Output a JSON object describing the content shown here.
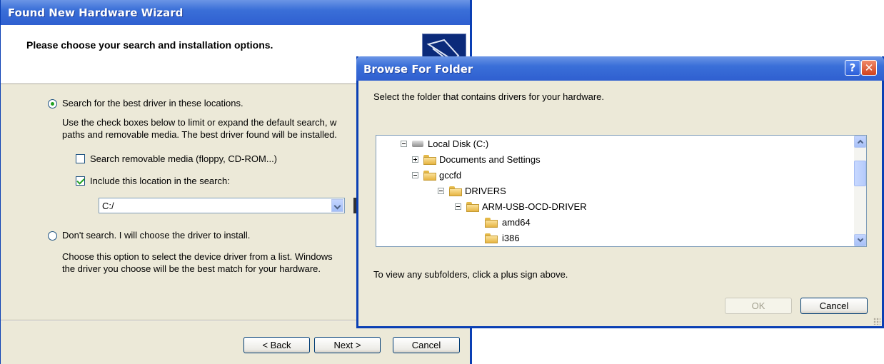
{
  "wizard": {
    "title": "Found New Hardware Wizard",
    "heading": "Please choose your search and installation options.",
    "search_option_label": "Search for the best driver in these locations.",
    "search_desc_line1": "Use the check boxes below to limit or expand the default search, w",
    "search_desc_line2": "paths and removable media. The best driver found will be installed.",
    "removable_media_label": "Search removable media (floppy, CD-ROM...)",
    "removable_media_checked": false,
    "include_location_label": "Include this location in the search:",
    "include_location_checked": true,
    "location_value": "C:/",
    "dont_search_label": "Don't search. I will choose the driver to install.",
    "dont_search_desc_line1": "Choose this option to select the device driver from a list.  Windows",
    "dont_search_desc_line2": "the driver you choose will be the best match for your hardware.",
    "selected_option": "search",
    "back_label": "< Back",
    "next_label": "Next >",
    "cancel_label": "Cancel"
  },
  "browse": {
    "title": "Browse For Folder",
    "help_glyph": "?",
    "close_glyph": "✕",
    "instruction": "Select the folder that contains drivers for your hardware.",
    "tree": [
      {
        "label": "Local Disk (C:)",
        "icon": "disk-icon",
        "expander": "minus"
      },
      {
        "label": "Documents and Settings",
        "icon": "folder-icon",
        "expander": "plus"
      },
      {
        "label": "gccfd",
        "icon": "folder-icon",
        "expander": "minus"
      },
      {
        "label": "DRIVERS",
        "icon": "folder-icon",
        "expander": "minus"
      },
      {
        "label": "ARM-USB-OCD-DRIVER",
        "icon": "folder-icon",
        "expander": "minus"
      },
      {
        "label": "amd64",
        "icon": "folder-icon",
        "expander": "none"
      },
      {
        "label": "i386",
        "icon": "folder-icon",
        "expander": "none"
      }
    ],
    "hint": "To view any subfolders, click a plus sign above.",
    "ok_label": "OK",
    "ok_disabled": true,
    "cancel_label": "Cancel"
  },
  "colors": {
    "titlebar": "#2f5fd0",
    "dialog_bg": "#ece9d8",
    "check_green": "#21a121"
  }
}
